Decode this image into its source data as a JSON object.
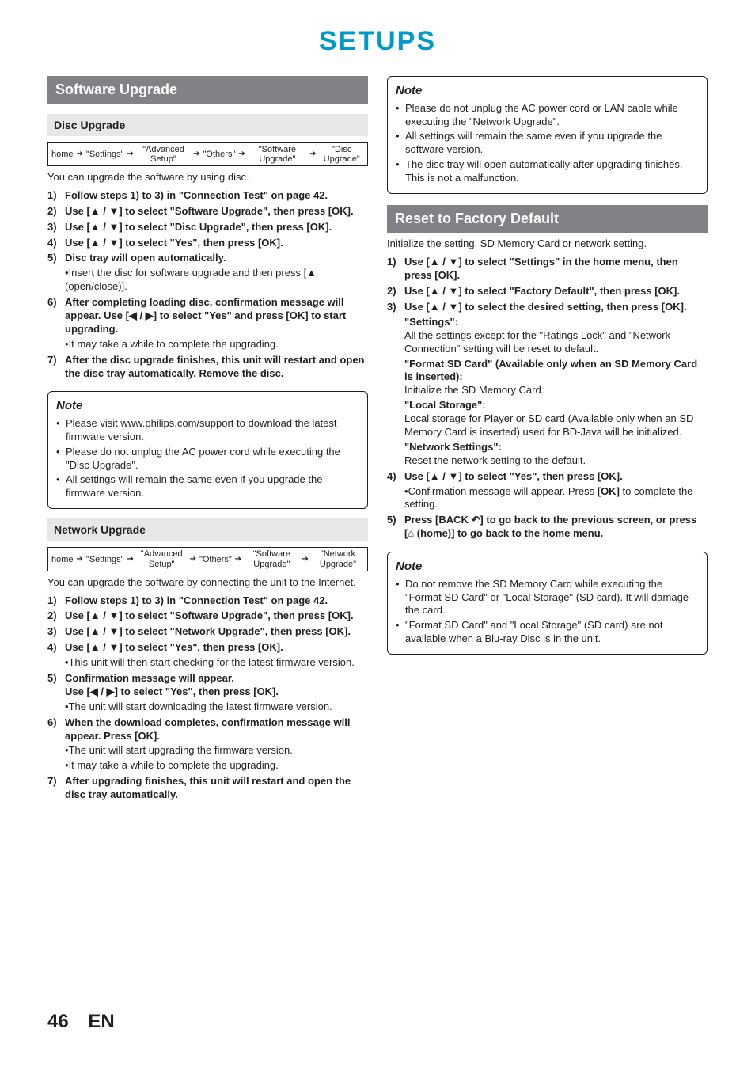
{
  "page_title": "SETUPS",
  "left": {
    "section_title": "Software Upgrade",
    "disc_upgrade": {
      "title": "Disc Upgrade",
      "breadcrumb": [
        "home",
        "\"Settings\"",
        "\"Advanced Setup\"",
        "\"Others\"",
        "\"Software Upgrade\"",
        "\"Disc Upgrade\""
      ],
      "intro": "You can upgrade the software by using disc.",
      "steps": [
        {
          "n": "1)",
          "t": "Follow steps 1) to 3) in \"Connection Test\" on page 42."
        },
        {
          "n": "2)",
          "t": "Use [▲ / ▼] to select \"Software Upgrade\", then press [OK]."
        },
        {
          "n": "3)",
          "t": "Use [▲ / ▼] to select \"Disc Upgrade\", then press [OK]."
        },
        {
          "n": "4)",
          "t": "Use [▲ / ▼] to select \"Yes\", then press [OK]."
        },
        {
          "n": "5)",
          "t": "Disc tray will open automatically.",
          "subs": [
            "Insert the disc for software upgrade and then press [▲ (open/close)]."
          ]
        },
        {
          "n": "6)",
          "t": "After completing loading disc, confirmation message will appear. Use [◀ / ▶] to select \"Yes\" and press [OK] to start upgrading.",
          "subs": [
            "It may take a while to complete the upgrading."
          ]
        },
        {
          "n": "7)",
          "t": "After the disc upgrade finishes, this unit will restart and open the disc tray automatically. Remove the disc."
        }
      ],
      "note_title": "Note",
      "notes": [
        "Please visit www.philips.com/support to download the latest firmware version.",
        "Please do not unplug the AC power cord while executing the \"Disc Upgrade\".",
        "All settings will remain the same even if you upgrade the firmware version."
      ]
    },
    "network_upgrade": {
      "title": "Network Upgrade",
      "breadcrumb": [
        "home",
        "\"Settings\"",
        "\"Advanced Setup\"",
        "\"Others\"",
        "\"Software Upgrade\"",
        "\"Network Upgrade\""
      ],
      "intro": "You can upgrade the software by connecting the unit to the Internet.",
      "steps": [
        {
          "n": "1)",
          "t": "Follow steps 1) to 3) in \"Connection Test\" on page 42."
        },
        {
          "n": "2)",
          "t": "Use [▲ / ▼] to select \"Software Upgrade\", then press [OK]."
        },
        {
          "n": "3)",
          "t": "Use [▲ / ▼] to select \"Network Upgrade\", then press [OK]."
        },
        {
          "n": "4)",
          "t": "Use [▲ / ▼] to select \"Yes\", then press [OK].",
          "subs": [
            "This unit will then start checking for the latest firmware version."
          ]
        },
        {
          "n": "5)",
          "t": "Confirmation message will appear.\nUse [◀ / ▶] to select \"Yes\", then press [OK].",
          "subs": [
            "The unit will start downloading the latest firmware version."
          ]
        },
        {
          "n": "6)",
          "t": "When the download completes, confirmation message will appear. Press [OK].",
          "subs": [
            "The unit will start upgrading the firmware version.",
            "It may take a while to complete the upgrading."
          ]
        },
        {
          "n": "7)",
          "t": "After upgrading finishes, this unit will restart and open the disc tray automatically."
        }
      ]
    }
  },
  "right": {
    "top_note": {
      "title": "Note",
      "items": [
        "Please do not unplug the AC power cord or LAN cable while executing the \"Network Upgrade\".",
        "All settings will remain the same even if you upgrade the software version.",
        "The disc tray will open automatically after upgrading finishes. This is not a malfunction."
      ]
    },
    "reset": {
      "title": "Reset to Factory Default",
      "intro": "Initialize the setting, SD Memory Card or network setting.",
      "steps": [
        {
          "n": "1)",
          "t": "Use [▲ / ▼] to select \"Settings\" in the home menu, then press [OK]."
        },
        {
          "n": "2)",
          "t": "Use [▲ / ▼] to select \"Factory Default\", then press [OK]."
        },
        {
          "n": "3)",
          "t": "Use [▲ / ▼] to select the desired setting, then press [OK].",
          "detail": [
            {
              "h": "\"Settings\":",
              "b": "All the settings except for the \"Ratings Lock\" and \"Network Connection\" setting will be reset to default."
            },
            {
              "h": "\"Format SD Card\" (Available only when an SD Memory Card is inserted):",
              "b": "Initialize the SD Memory Card."
            },
            {
              "h": "\"Local Storage\":",
              "b": "Local storage for Player or SD card (Available only when an SD Memory Card is inserted) used for BD-Java will be initialized."
            },
            {
              "h": "\"Network Settings\":",
              "b": "Reset the network setting to the default."
            }
          ]
        },
        {
          "n": "4)",
          "t": "Use [▲ / ▼] to select \"Yes\", then press [OK].",
          "subs": [
            "Confirmation message will appear. Press [OK] to complete the setting."
          ],
          "subs_bold": [
            "[OK]"
          ]
        },
        {
          "n": "5)",
          "t": "Press [BACK ↶] to go back to the previous screen, or press [⌂ (home)] to go back to the home menu."
        }
      ],
      "note_title": "Note",
      "notes": [
        "Do not remove the SD Memory Card while executing the \"Format SD Card\" or \"Local Storage\" (SD card). It will damage the card.",
        "\"Format SD Card\" and \"Local Storage\" (SD card) are not available when a Blu-ray Disc is in the unit."
      ]
    }
  },
  "footer": {
    "page": "46",
    "lang": "EN"
  }
}
